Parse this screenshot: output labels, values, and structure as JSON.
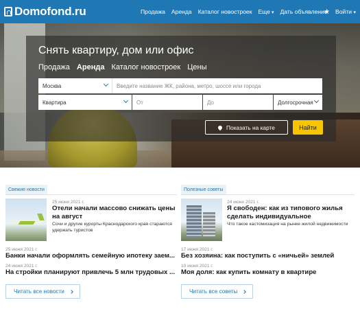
{
  "header": {
    "logo": "Domofond.ru",
    "nav": [
      {
        "label": "Продажа"
      },
      {
        "label": "Аренда"
      },
      {
        "label": "Каталог новостроек"
      },
      {
        "label": "Еще"
      },
      {
        "label": "Дать объявление"
      }
    ],
    "login": "Войти",
    "colors": {
      "bar": "#1f78b4"
    }
  },
  "search": {
    "title": "Снять квартиру, дом или офис",
    "tabs": [
      "Продажа",
      "Аренда",
      "Каталог новостроек",
      "Цены"
    ],
    "active_tab": "Аренда",
    "city_value": "Москва",
    "query_placeholder": "Введите название ЖК, района, метро, шоссе или города",
    "type_value": "Квартира",
    "price_from_placeholder": "От",
    "price_to_placeholder": "До",
    "term_value": "Долгосрочная",
    "map_button": "Показать на карте",
    "find_button": "Найти",
    "colors": {
      "find": "#f7c600"
    }
  },
  "news": {
    "badge": "Свежие новости",
    "featured": {
      "date": "25 июня 2021 г.",
      "title": "Отели начали массово снижать цены на август",
      "desc": "Сочи и другие курорты Краснодарского края стараются удержать туристов"
    },
    "items": [
      {
        "date": "25 июня 2021 г.",
        "title": "Банки начали оформлять семейную ипотеку заем..."
      },
      {
        "date": "24 июня 2021 г.",
        "title": "На стройки планируют привлечь 5 млн трудовых ..."
      }
    ],
    "more": "Читать все новости"
  },
  "tips": {
    "badge": "Полезные советы",
    "featured": {
      "date": "24 июня 2021 г.",
      "title": "Я свободен: как из типового жилья сделать индивидуальное",
      "desc": "Что такое кастомизация на рынке жилой недвижимости"
    },
    "items": [
      {
        "date": "17 июня 2021 г.",
        "title": "Без хозяина: как поступить с «ничьей» землей"
      },
      {
        "date": "10 июня 2021 г.",
        "title": "Моя доля: как купить комнату в квартире"
      }
    ],
    "more": "Читать все советы"
  }
}
